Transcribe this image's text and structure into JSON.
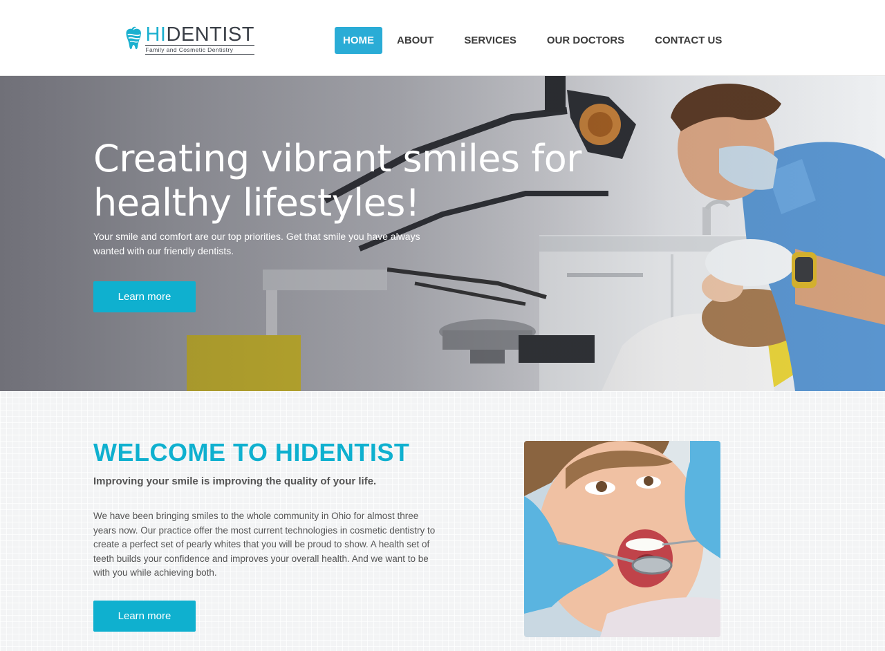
{
  "brand": {
    "name_hi": "HI",
    "name_rest": "DENTIST",
    "tagline": "Family and Cosmetic Dentistry",
    "logo_icon": "tooth-icon",
    "accent_color": "#1bb0cf"
  },
  "nav": {
    "items": [
      {
        "label": "HOME",
        "active": true
      },
      {
        "label": "ABOUT",
        "active": false
      },
      {
        "label": "SERVICES",
        "active": false
      },
      {
        "label": "OUR DOCTORS",
        "active": false
      },
      {
        "label": "CONTACT US",
        "active": false
      }
    ]
  },
  "hero": {
    "title": "Creating vibrant smiles for healthy lifestyles!",
    "text": "Your smile and comfort are our top priorities. Get that smile you have always wanted with our friendly dentists.",
    "button_label": "Learn more",
    "image": "dentist-treating-patient-photo"
  },
  "welcome": {
    "title": "WELCOME TO HIDENTIST",
    "subtitle": "Improving your smile is improving the quality of your life.",
    "body": "We have been bringing smiles to the whole community in Ohio for almost three years now. Our practice offer the most current technologies in cosmetic dentistry to create a perfect set of pearly whites that you will be proud to show. A health set of teeth builds your confidence and improves your overall health. And we want to be with you while achieving both.",
    "button_label": "Learn more",
    "image": "child-dental-checkup-photo"
  },
  "colors": {
    "primary": "#0fb0cf",
    "nav_active": "#2aacd6",
    "text_dark": "#3b3b3b"
  }
}
